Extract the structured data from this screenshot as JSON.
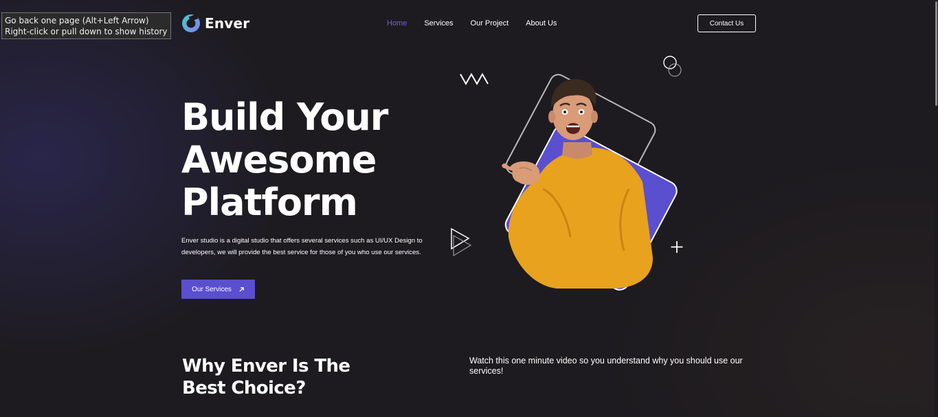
{
  "tooltip": {
    "line1": "Go back one page (Alt+Left Arrow)",
    "line2": "Right-click or pull down to show history"
  },
  "header": {
    "logo_text": "Enver",
    "nav": [
      {
        "label": "Home",
        "active": true
      },
      {
        "label": "Services",
        "active": false
      },
      {
        "label": "Our Project",
        "active": false
      },
      {
        "label": "About Us",
        "active": false
      }
    ],
    "contact_label": "Contact Us"
  },
  "hero": {
    "title_lines": [
      "Build Your",
      "Awesome",
      "Platform"
    ],
    "description": "Enver studio is a digital studio that offers several services such as UI/UX Design to developers, we will provide the best service for those of you who use our services.",
    "cta_label": "Our Services",
    "cta_icon": "arrow-up-right-icon"
  },
  "why": {
    "title_lines": [
      "Why Enver Is The",
      "Best Choice?"
    ],
    "text": "Watch this one minute video so you understand why you should use our services!"
  },
  "colors": {
    "background": "#1d1b1f",
    "accent": "#5a4fcf",
    "nav_active": "#6c63e8",
    "sweater": "#e8a21e"
  }
}
